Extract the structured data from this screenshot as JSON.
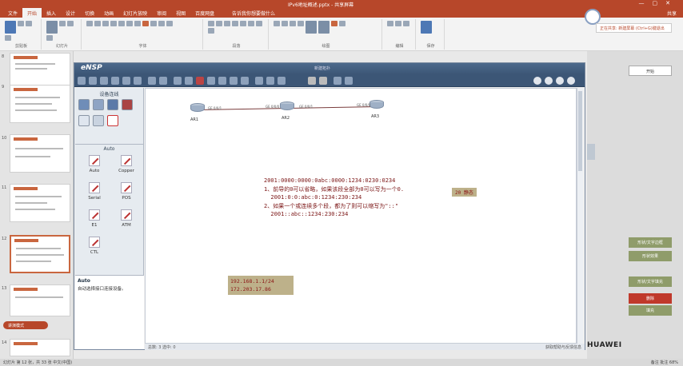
{
  "ppt": {
    "title": "IPv6地址概述.pptx - 共享屏幕",
    "tabs": [
      "文件",
      "开始",
      "插入",
      "设计",
      "切换",
      "动画",
      "幻灯片放映",
      "审阅",
      "视图",
      "百度网盘"
    ],
    "search_placeholder": "告诉我你想要做什么",
    "user": "共享",
    "ribbon_groups": [
      "剪贴板",
      "幻灯片",
      "字体",
      "段落",
      "绘图",
      "编辑",
      "保存"
    ],
    "notification": "正在共享: 新建屏幕 (Ctrl+G)键退出",
    "slide_numbers": [
      "8",
      "9",
      "10",
      "11",
      "12",
      "13",
      "14"
    ],
    "pill_label": "讲演模式",
    "status_left": "幻灯片 第 12 张，共 33 张  中文(中国)",
    "status_right": "备注  批注  68%"
  },
  "right_pane": {
    "buttons": [
      "开始",
      "形状/文字边框",
      "形状效果",
      "形状/文字填充",
      "删除",
      "填充"
    ],
    "brand": "HUAWEI"
  },
  "ensp": {
    "logo": "eNSP",
    "window_title": "新建拓扑",
    "device_panel_title": "设备连线",
    "cable_section": "Auto",
    "cables": [
      "Auto",
      "Copper",
      "Serial",
      "POS",
      "E1",
      "ATM",
      "CTL"
    ],
    "desc_title": "Auto",
    "desc_text": "自动选择接口连接设备。",
    "status_left": "总数: 3  选中: 0",
    "status_right": "获取帮助与反馈信息"
  },
  "topology": {
    "routers": [
      "AR1",
      "AR2",
      "AR3"
    ],
    "ports": [
      "GE 0/0/1",
      "GE 0/0/0",
      "GE 0/0/1",
      "GE 0/0/0"
    ],
    "note": "20 静态"
  },
  "canvas_text": {
    "lines": [
      "2001:0000:0000:0abc:0000:1234:0230:0234",
      "1、前导的0可以省略，如果该段全部为0可以写为一个0.",
      "  2001:0:0:abc:0:1234:230:234",
      "2、如果一个或连续多个段，都为了则可以缩写为\"::\"",
      "  2001::abc::1234:230:234"
    ],
    "ip_lines": [
      "192.168.1.1/24",
      "172.203.17.86"
    ]
  }
}
